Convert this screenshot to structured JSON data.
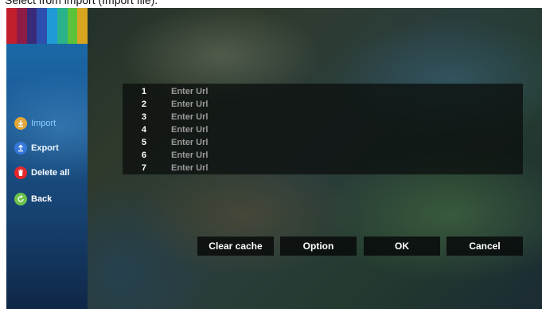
{
  "caption": "Select from import (Import file).",
  "sidebar": {
    "stripe_colors": [
      "#c21f2e",
      "#8f1c47",
      "#3a2a7a",
      "#2d4fb0",
      "#1f9ad6",
      "#2ab38a",
      "#5cc23a",
      "#d9a521"
    ],
    "items": [
      {
        "label": "Import",
        "icon": "import-icon",
        "color": "#f2a21a",
        "active": true
      },
      {
        "label": "Export",
        "icon": "export-icon",
        "color": "#2f6fd8",
        "active": false
      },
      {
        "label": "Delete all",
        "icon": "trash-icon",
        "color": "#e3262a",
        "active": false
      },
      {
        "label": "Back",
        "icon": "back-icon",
        "color": "#6cc24a",
        "active": false
      }
    ]
  },
  "url_list": {
    "rows": [
      {
        "number": "1",
        "placeholder": "Enter Url"
      },
      {
        "number": "2",
        "placeholder": "Enter Url"
      },
      {
        "number": "3",
        "placeholder": "Enter Url"
      },
      {
        "number": "4",
        "placeholder": "Enter Url"
      },
      {
        "number": "5",
        "placeholder": "Enter Url"
      },
      {
        "number": "6",
        "placeholder": "Enter Url"
      },
      {
        "number": "7",
        "placeholder": "Enter Url"
      }
    ]
  },
  "buttons": {
    "clear_cache": "Clear cache",
    "option": "Option",
    "ok": "OK",
    "cancel": "Cancel"
  }
}
